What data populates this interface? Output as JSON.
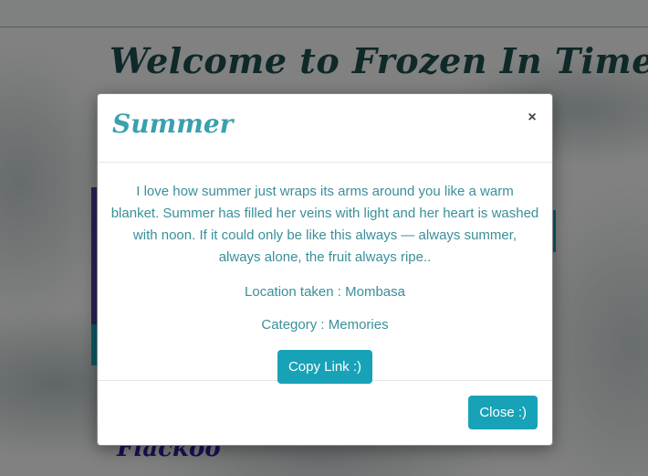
{
  "page": {
    "title": "Welcome to Frozen In Time",
    "bottom_name": "Flackoo"
  },
  "modal": {
    "title": "Summer",
    "close_symbol": "×",
    "description": "I love how summer just wraps its arms around you like a warm blanket. Summer has filled her veins with light and her heart is washed with noon. If it could only be like this always — always summer, always alone, the fruit always ripe..",
    "location_label": "Location taken : ",
    "location_value": "Mombasa",
    "category_label": "Category : ",
    "category_value": "Memories",
    "copy_button": "Copy Link :)",
    "close_button": "Close :)"
  },
  "colors": {
    "accent": "#17a2b8",
    "title_text": "#3aa0ad",
    "page_title": "#1d4a4a",
    "bottom_name": "#2a1f9c"
  }
}
